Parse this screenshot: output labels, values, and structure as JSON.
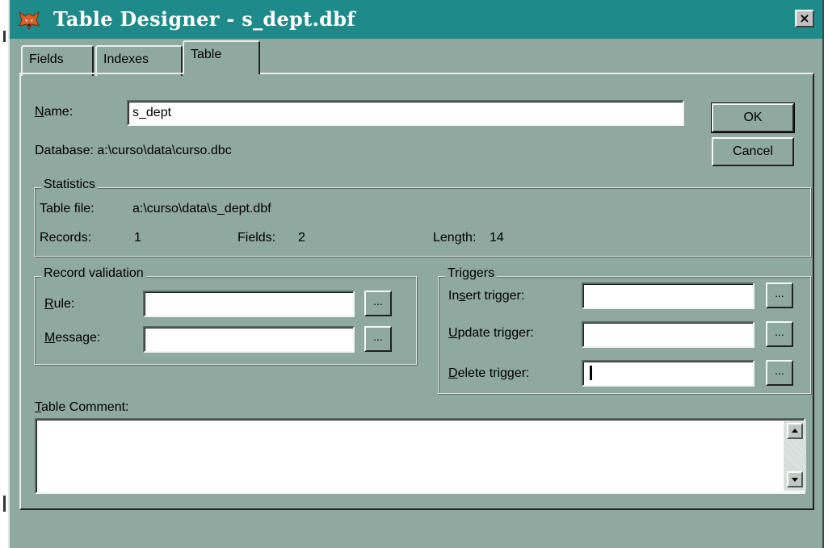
{
  "window": {
    "title": "Table Designer - s_dept.dbf",
    "close_label": "×"
  },
  "tabs": [
    {
      "label": "Fields",
      "active": false
    },
    {
      "label": "Indexes",
      "active": false
    },
    {
      "label": "Table",
      "active": true
    }
  ],
  "table": {
    "name_label": "Name:",
    "name_value": "s_dept",
    "database_text": "Database:  a:\\curso\\data\\curso.dbc",
    "ok_label": "OK",
    "cancel_label": "Cancel"
  },
  "statistics": {
    "legend": "Statistics",
    "table_file_label": "Table file:",
    "table_file_value": "a:\\curso\\data\\s_dept.dbf",
    "records_label": "Records:",
    "records_value": "1",
    "fields_label": "Fields:",
    "fields_value": "2",
    "length_label": "Length:",
    "length_value": "14"
  },
  "record_validation": {
    "legend": "Record validation",
    "rule_label": "Rule:",
    "rule_value": "",
    "message_label": "Message:",
    "message_value": "",
    "ellipsis": "..."
  },
  "triggers": {
    "legend": "Triggers",
    "insert_label": "Insert trigger:",
    "insert_value": "",
    "update_label": "Update trigger:",
    "update_value": "",
    "delete_label": "Delete trigger:",
    "delete_value": "",
    "ellipsis": "..."
  },
  "comment": {
    "label": "Table Comment:",
    "value": ""
  },
  "colors": {
    "titlebar": "#1e8a8a",
    "dialog": "#8fa8a0"
  },
  "icons": {
    "app": "foxpro-fox-icon",
    "close": "close-icon",
    "scroll_up": "scroll-up-arrow-icon",
    "scroll_down": "scroll-down-arrow-icon"
  }
}
